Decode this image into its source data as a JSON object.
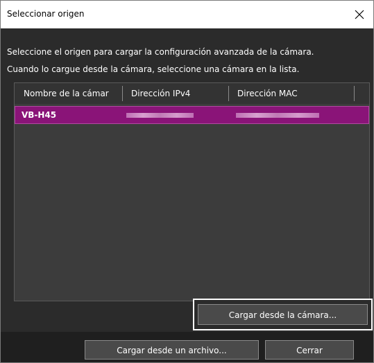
{
  "window": {
    "title": "Seleccionar origen",
    "close_label": "close"
  },
  "description": {
    "line1": "Seleccione el origen para cargar la configuración avanzada de la cámara.",
    "line2": "Cuando lo cargue desde la cámara, seleccione una cámara en la lista."
  },
  "list": {
    "columns": [
      "Nombre de la cámar",
      "Dirección IPv4",
      "Dirección MAC"
    ],
    "rows": [
      {
        "name": "VB-H45"
      }
    ]
  },
  "buttons": {
    "load_camera": "Cargar desde la cámara...",
    "load_file": "Cargar desde un archivo...",
    "close": "Cerrar"
  },
  "colors": {
    "selected_row": "#8a1478",
    "dialog_bg": "#2b2b2b"
  }
}
